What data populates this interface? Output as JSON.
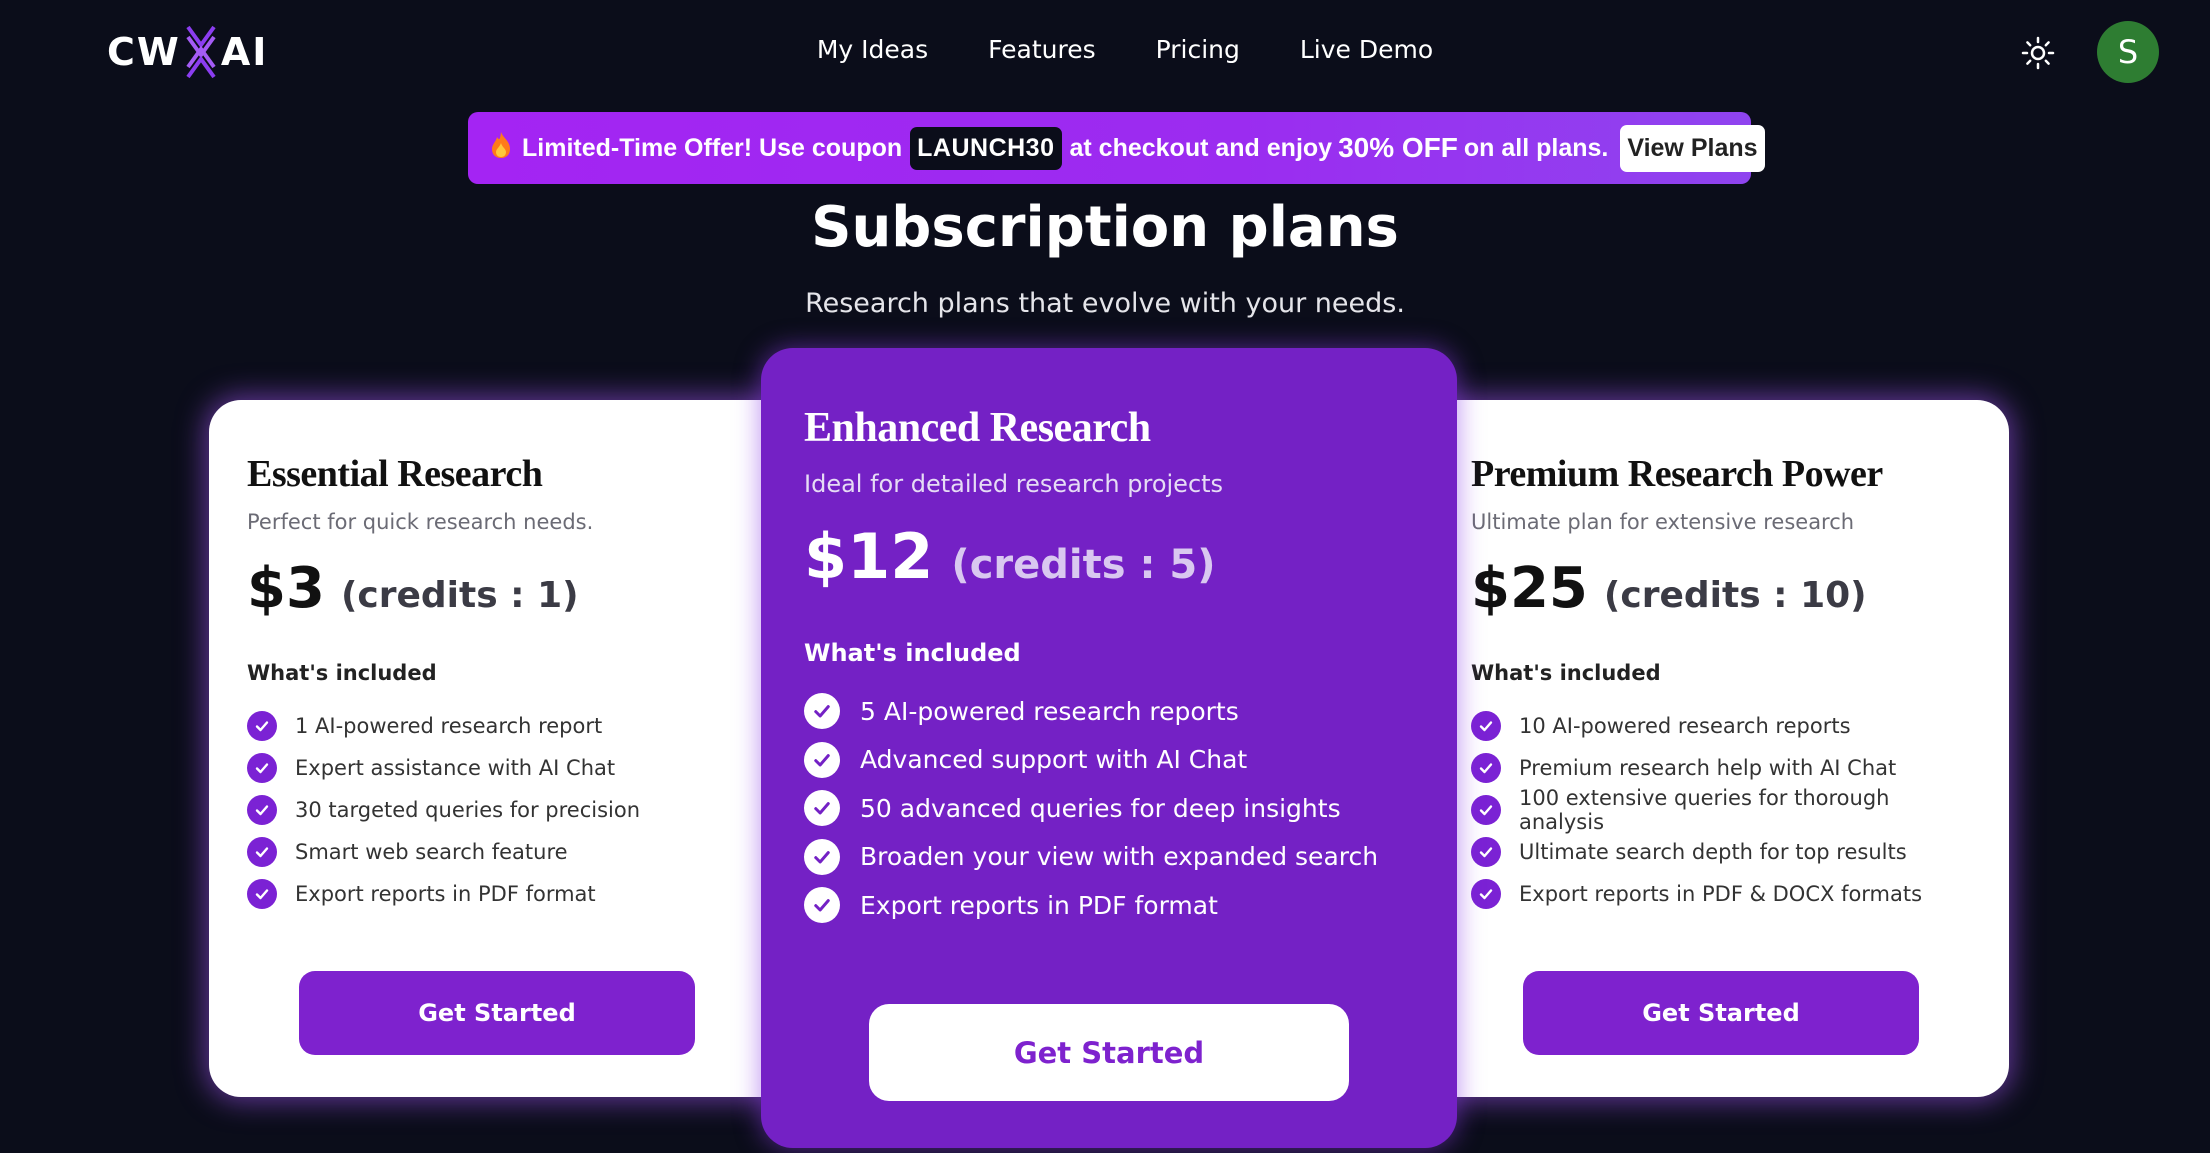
{
  "header": {
    "logo_left": "CW",
    "logo_right": "AI",
    "nav": [
      "My Ideas",
      "Features",
      "Pricing",
      "Live Demo"
    ],
    "theme_icon": "sun-icon",
    "avatar_initial": "S"
  },
  "promo": {
    "icon": "fire-icon",
    "text_before": "Limited-Time Offer! Use coupon",
    "coupon": "LAUNCH30",
    "text_middle": "at checkout and enjoy",
    "offer": "30% OFF",
    "text_after": "on all plans.",
    "button": "View Plans"
  },
  "title": "Subscription plans",
  "subtitle": "Research plans that evolve with your needs.",
  "plans": [
    {
      "name": "Essential Research",
      "description": "Perfect for quick research needs.",
      "price": "$3",
      "credits": "(credits : 1)",
      "included_label": "What's included",
      "features": [
        "1 AI-powered research report",
        "Expert assistance with AI Chat",
        "30 targeted queries for precision",
        "Smart web search feature",
        "Export reports in PDF format"
      ],
      "button": "Get Started"
    },
    {
      "name": "Enhanced Research",
      "description": "Ideal for detailed research projects",
      "price": "$12",
      "credits": "(credits : 5)",
      "included_label": "What's included",
      "features": [
        "5 AI-powered research reports",
        "Advanced support with AI Chat",
        "50 advanced queries for deep insights",
        "Broaden your view with expanded search",
        "Export reports in PDF format"
      ],
      "button": "Get Started"
    },
    {
      "name": "Premium Research Power",
      "description": "Ultimate plan for extensive research",
      "price": "$25",
      "credits": "(credits : 10)",
      "included_label": "What's included",
      "features": [
        "10 AI-powered research reports",
        "Premium research help with AI Chat",
        "100 extensive queries for thorough analysis",
        "Ultimate search depth for top results",
        "Export reports in PDF & DOCX formats"
      ],
      "button": "Get Started"
    }
  ],
  "colors": {
    "background": "#0b0d1a",
    "accent": "#7e22ce",
    "featured_card": "#7421c5",
    "avatar": "#2e7d32"
  }
}
